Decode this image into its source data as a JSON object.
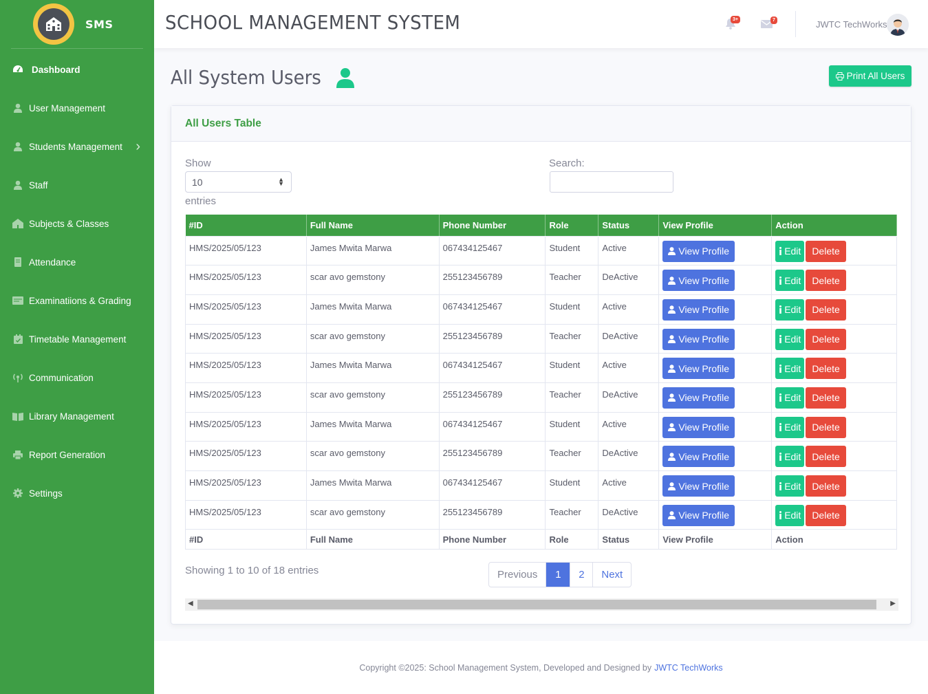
{
  "brand": {
    "name": "SMS"
  },
  "sidebar": {
    "items": [
      {
        "label": "Dashboard",
        "icon": "dashboard-icon"
      },
      {
        "label": "User Management",
        "icon": "user-icon"
      },
      {
        "label": "Students Management",
        "icon": "user-icon"
      },
      {
        "label": "Staff",
        "icon": "user-icon"
      },
      {
        "label": "Subjects & Classes",
        "icon": "school-icon"
      },
      {
        "label": "Attendance",
        "icon": "book-icon"
      },
      {
        "label": "Examinatiions & Grading",
        "icon": "id-card-icon"
      },
      {
        "label": "Timetable Management",
        "icon": "calendar-icon"
      },
      {
        "label": "Communication",
        "icon": "broadcast-icon"
      },
      {
        "label": "Library Management",
        "icon": "open-book-icon"
      },
      {
        "label": "Report Generation",
        "icon": "print-icon"
      },
      {
        "label": "Settings",
        "icon": "gear-icon"
      }
    ]
  },
  "header": {
    "title": "SCHOOL MANAGEMENT SYSTEM",
    "alerts_badge": "3+",
    "messages_badge": "7",
    "user_name": "JWTC TechWorks"
  },
  "page": {
    "heading": "All System Users",
    "print_button": "Print All Users"
  },
  "card": {
    "title": "All Users Table"
  },
  "controls": {
    "show_label": "Show",
    "entries_value": "10",
    "entries_label": "entries",
    "search_label": "Search:",
    "search_value": ""
  },
  "table": {
    "columns": [
      "#ID",
      "Full Name",
      "Phone Number",
      "Role",
      "Status",
      "View Profile",
      "Action"
    ],
    "rows": [
      [
        "HMS/2025/05/123",
        "James Mwita Marwa",
        "067434125467",
        "Student",
        "Active"
      ],
      [
        "HMS/2025/05/123",
        "scar avo gemstony",
        "255123456789",
        "Teacher",
        "DeActive"
      ],
      [
        "HMS/2025/05/123",
        "James Mwita Marwa",
        "067434125467",
        "Student",
        "Active"
      ],
      [
        "HMS/2025/05/123",
        "scar avo gemstony",
        "255123456789",
        "Teacher",
        "DeActive"
      ],
      [
        "HMS/2025/05/123",
        "James Mwita Marwa",
        "067434125467",
        "Student",
        "Active"
      ],
      [
        "HMS/2025/05/123",
        "scar avo gemstony",
        "255123456789",
        "Teacher",
        "DeActive"
      ],
      [
        "HMS/2025/05/123",
        "James Mwita Marwa",
        "067434125467",
        "Student",
        "Active"
      ],
      [
        "HMS/2025/05/123",
        "scar avo gemstony",
        "255123456789",
        "Teacher",
        "DeActive"
      ],
      [
        "HMS/2025/05/123",
        "James Mwita Marwa",
        "067434125467",
        "Student",
        "Active"
      ],
      [
        "HMS/2025/05/123",
        "scar avo gemstony",
        "255123456789",
        "Teacher",
        "DeActive"
      ]
    ],
    "view_button": "View Profile",
    "edit_button": "Edit",
    "delete_button": "Delete"
  },
  "pagination": {
    "info": "Showing 1 to 10 of 18 entries",
    "previous": "Previous",
    "pages": [
      "1",
      "2"
    ],
    "next": "Next"
  },
  "footer": {
    "text": "Copyright ©2025: School Management System, Developed and Designed by",
    "link": "JWTC TechWorks"
  },
  "colors": {
    "primary_green": "#3e9e45",
    "success": "#1cc88a",
    "primary_blue": "#4e73df",
    "danger": "#e74a3b",
    "logo_yellow": "#f3c443"
  }
}
